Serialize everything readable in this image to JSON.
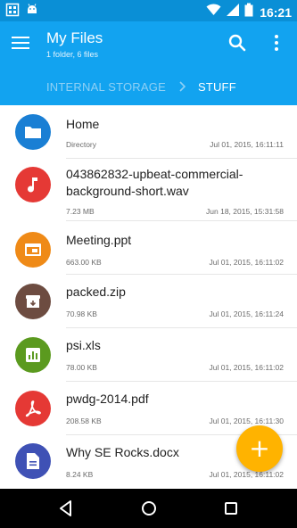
{
  "status_bar": {
    "time": "16:21",
    "left_icons": [
      "gallery-notification-icon",
      "android-debug-icon"
    ],
    "right_icons": [
      "wifi-icon",
      "cell-signal-icon",
      "battery-icon"
    ]
  },
  "app_bar": {
    "title": "My Files",
    "subtitle": "1 folder, 6 files",
    "color": "#12a3f0"
  },
  "breadcrumb": {
    "items": [
      "INTERNAL STORAGE",
      "STUFF"
    ]
  },
  "files": [
    {
      "name": "Home",
      "type_or_size": "Directory",
      "date": "Jul 01, 2015, 16:11:11",
      "icon": "folder-icon",
      "color": "#1a7fd4"
    },
    {
      "name": "043862832-upbeat-commercial-background-short.wav",
      "type_or_size": "7.23 MB",
      "date": "Jun 18, 2015, 15:31:58",
      "icon": "music-note-icon",
      "color": "#e53935"
    },
    {
      "name": "Meeting.ppt",
      "type_or_size": "663.00 KB",
      "date": "Jul 01, 2015, 16:11:02",
      "icon": "presentation-icon",
      "color": "#ef8a17"
    },
    {
      "name": "packed.zip",
      "type_or_size": "70.98 KB",
      "date": "Jul 01, 2015, 16:11:24",
      "icon": "archive-icon",
      "color": "#6d4c41"
    },
    {
      "name": "psi.xls",
      "type_or_size": "78.00 KB",
      "date": "Jul 01, 2015, 16:11:02",
      "icon": "spreadsheet-icon",
      "color": "#5b9a1f"
    },
    {
      "name": "pwdg-2014.pdf",
      "type_or_size": "208.58 KB",
      "date": "Jul 01, 2015, 16:11:30",
      "icon": "pdf-icon",
      "color": "#e53935"
    },
    {
      "name": "Why SE Rocks.docx",
      "type_or_size": "8.24 KB",
      "date": "Jul 01, 2015, 16:11:02",
      "icon": "document-icon",
      "color": "#3f51b5"
    }
  ],
  "fab": {
    "label": "+",
    "color": "#ffb300"
  }
}
